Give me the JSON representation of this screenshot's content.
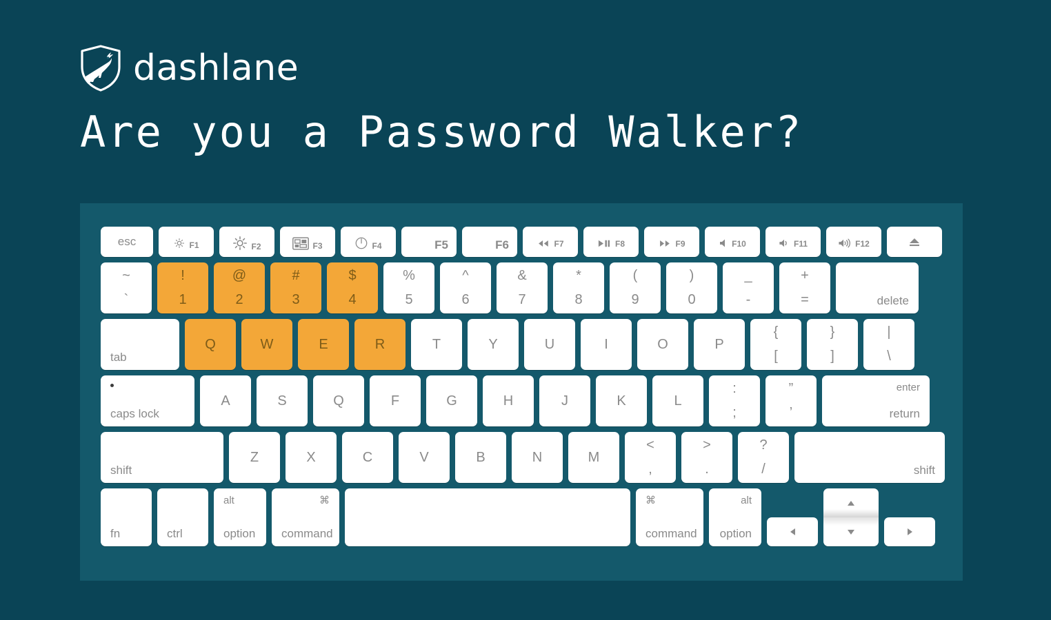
{
  "brand": {
    "wordmark": "dashlane",
    "logo_icon": "shield-deer-icon"
  },
  "headline": "Are you a Password Walker?",
  "colors": {
    "page_background": "#0a4456",
    "panel_background": "#14596b",
    "key_face": "#ffffff",
    "key_text": "#8a8a8a",
    "highlight_key": "#f3a738",
    "highlight_key_text": "#7e5c18"
  },
  "keyboard": {
    "highlighted_keys": [
      "1",
      "2",
      "3",
      "4",
      "Q",
      "W",
      "E",
      "R"
    ],
    "rows": {
      "function": [
        {
          "label": "esc",
          "icon": null
        },
        {
          "label": "F1",
          "icon": "brightness-down-icon"
        },
        {
          "label": "F2",
          "icon": "brightness-up-icon"
        },
        {
          "label": "F3",
          "icon": "mission-control-icon"
        },
        {
          "label": "F4",
          "icon": "dashboard-gauge-icon"
        },
        {
          "label": "F5",
          "icon": null
        },
        {
          "label": "F6",
          "icon": null
        },
        {
          "label": "F7",
          "icon": "rewind-icon"
        },
        {
          "label": "F8",
          "icon": "play-pause-icon"
        },
        {
          "label": "F9",
          "icon": "fast-forward-icon"
        },
        {
          "label": "F10",
          "icon": "mute-icon"
        },
        {
          "label": "F11",
          "icon": "volume-down-icon"
        },
        {
          "label": "F12",
          "icon": "volume-up-icon"
        },
        {
          "label": "",
          "icon": "eject-icon"
        }
      ],
      "number": [
        {
          "top": "~",
          "bottom": "`"
        },
        {
          "top": "!",
          "bottom": "1"
        },
        {
          "top": "@",
          "bottom": "2"
        },
        {
          "top": "#",
          "bottom": "3"
        },
        {
          "top": "$",
          "bottom": "4"
        },
        {
          "top": "%",
          "bottom": "5"
        },
        {
          "top": "^",
          "bottom": "6"
        },
        {
          "top": "&",
          "bottom": "7"
        },
        {
          "top": "*",
          "bottom": "8"
        },
        {
          "top": "(",
          "bottom": "9"
        },
        {
          "top": ")",
          "bottom": "0"
        },
        {
          "top": "_",
          "bottom": "-"
        },
        {
          "top": "+",
          "bottom": "="
        },
        {
          "label": "delete"
        }
      ],
      "qwerty": [
        {
          "label": "tab"
        },
        {
          "center": "Q"
        },
        {
          "center": "W"
        },
        {
          "center": "E"
        },
        {
          "center": "R"
        },
        {
          "center": "T"
        },
        {
          "center": "Y"
        },
        {
          "center": "U"
        },
        {
          "center": "I"
        },
        {
          "center": "O"
        },
        {
          "center": "P"
        },
        {
          "top": "{",
          "bottom": "["
        },
        {
          "top": "}",
          "bottom": "]"
        },
        {
          "top": "|",
          "bottom": "\\"
        }
      ],
      "home": [
        {
          "label": "caps lock"
        },
        {
          "center": "A"
        },
        {
          "center": "S"
        },
        {
          "center": "Q"
        },
        {
          "center": "F"
        },
        {
          "center": "G"
        },
        {
          "center": "H"
        },
        {
          "center": "J"
        },
        {
          "center": "K"
        },
        {
          "center": "L"
        },
        {
          "top": ":",
          "bottom": ";"
        },
        {
          "top": "”",
          "bottom": "’"
        },
        {
          "label_top": "enter",
          "label_bottom": "return"
        }
      ],
      "shift": [
        {
          "label": "shift"
        },
        {
          "center": "Z"
        },
        {
          "center": "X"
        },
        {
          "center": "C"
        },
        {
          "center": "V"
        },
        {
          "center": "B"
        },
        {
          "center": "N"
        },
        {
          "center": "M"
        },
        {
          "top": "<",
          "bottom": ","
        },
        {
          "top": ">",
          "bottom": "."
        },
        {
          "top": "?",
          "bottom": "/"
        },
        {
          "label": "shift"
        }
      ],
      "bottom": [
        {
          "label": "fn"
        },
        {
          "label": "ctrl"
        },
        {
          "label_top": "alt",
          "label_bottom": "option"
        },
        {
          "label_top": "⌘",
          "label_bottom": "command"
        },
        {
          "label": ""
        },
        {
          "label_top": "⌘",
          "label_bottom": "command"
        },
        {
          "label_top": "alt",
          "label_bottom": "option"
        },
        {
          "label": "left-arrow"
        },
        {
          "label": "up-arrow"
        },
        {
          "label": "down-arrow"
        },
        {
          "label": "right-arrow"
        }
      ]
    }
  }
}
